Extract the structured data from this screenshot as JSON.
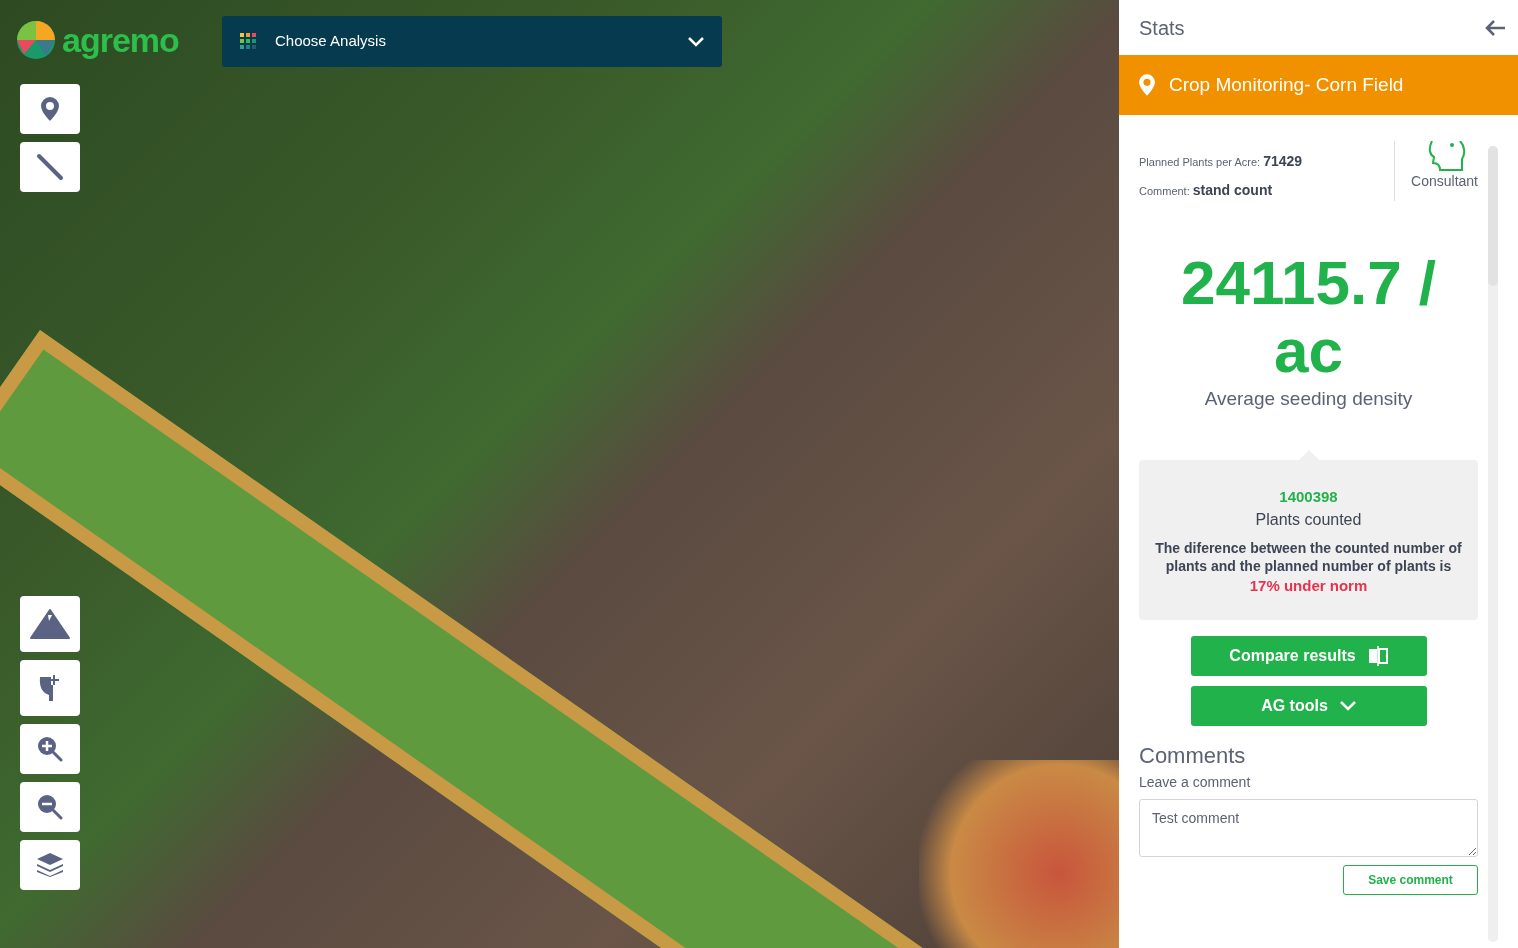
{
  "logo": {
    "text": "agremo"
  },
  "analysis_dropdown": {
    "label": "Choose Analysis"
  },
  "panel": {
    "title": "Stats",
    "field_header": "Crop Monitoring- Corn Field",
    "planned": {
      "label": "Planned Plants per Acre:",
      "value": "71429"
    },
    "comment": {
      "label": "Comment:",
      "value": "stand count"
    },
    "role": "Consultant",
    "density": {
      "value": "24115.7 / ac",
      "label": "Average seeding density"
    },
    "summary": {
      "count": "1400398",
      "count_label": "Plants counted",
      "explanation": "The diference between the counted number of plants and the planned number of plants is",
      "difference": "17% under norm"
    },
    "buttons": [
      {
        "kind": "compare",
        "label": "Compare results"
      },
      {
        "kind": "dropdown",
        "label": "AG tools"
      }
    ],
    "comments": {
      "heading": "Comments",
      "hint": "Leave a comment",
      "value": "Test comment",
      "save": "Save comment"
    }
  }
}
